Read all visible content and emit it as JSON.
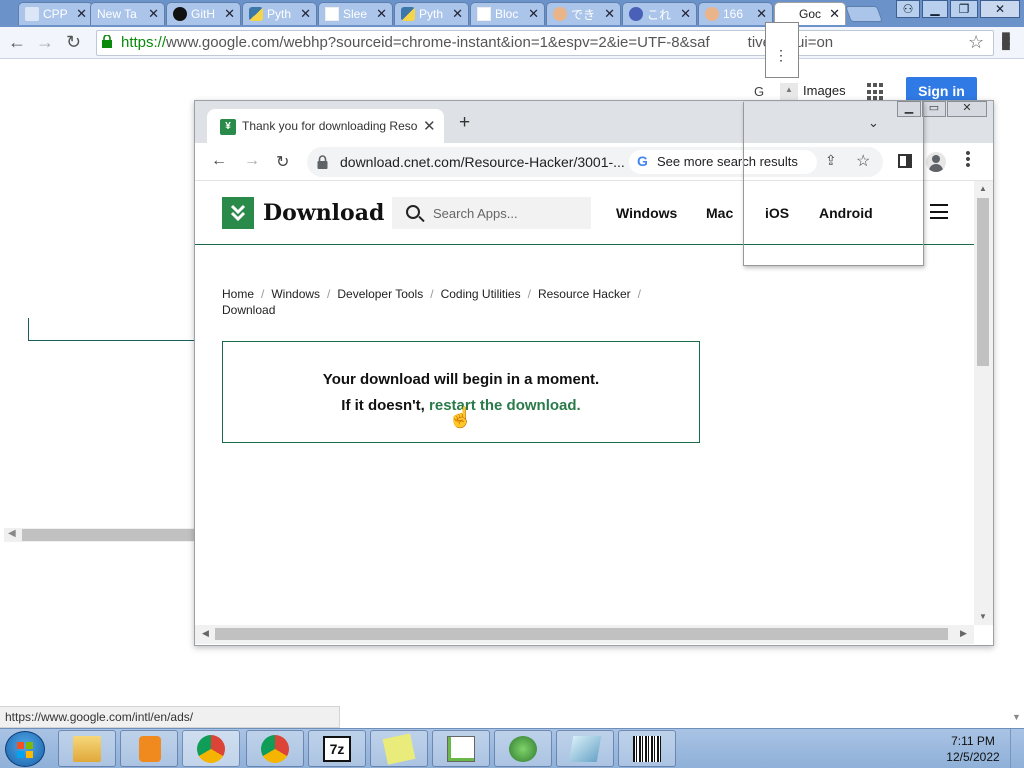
{
  "bg_window": {
    "tabs": [
      {
        "label": "CPP",
        "icon": "chrome-icon"
      },
      {
        "label": "New Ta",
        "icon": "page-icon"
      },
      {
        "label": "GitH",
        "icon": "github-icon"
      },
      {
        "label": "Pyth",
        "icon": "python-icon"
      },
      {
        "label": "Slee",
        "icon": "page-icon"
      },
      {
        "label": "Pyth",
        "icon": "python-icon"
      },
      {
        "label": "Bloc",
        "icon": "page-icon"
      },
      {
        "label": "でき",
        "icon": "anime-icon"
      },
      {
        "label": "これ",
        "icon": "anime-icon"
      },
      {
        "label": "166",
        "icon": "anime-icon"
      },
      {
        "label": "Goc",
        "icon": "google-icon"
      }
    ],
    "url_scheme": "https://",
    "url_rest": "www.google.com/webhp?sourceid=chrome-instant&ion=1&espv=2&ie=UTF-8&saf",
    "url_tail": "tive&ssui=on",
    "google_g": "G",
    "images_label": "Images",
    "signin_label": "Sign in",
    "status_url": "https://www.google.com/intl/en/ads/"
  },
  "fg_window": {
    "tab_title": "Thank you for downloading Resource Hacker",
    "new_tab_label": "+",
    "tab_search_label": "⌄",
    "url": "download.cnet.com/Resource-Hacker/3001-...",
    "chip_label": "See more search results",
    "chip_logo": "G"
  },
  "site": {
    "logo_text": "Download",
    "search_placeholder": "Search Apps...",
    "nav": [
      "Windows",
      "Mac",
      "iOS",
      "Android"
    ],
    "breadcrumb": [
      "Home",
      "Windows",
      "Developer Tools",
      "Coding Utilities",
      "Resource Hacker",
      "Download"
    ],
    "breadcrumb_sep": "/",
    "message_line1": "Your download will begin in a moment.",
    "message_line2_prefix": "If it doesn't,",
    "message_link": "restart the download."
  },
  "taskbar": {
    "time": "7:11 PM",
    "date": "12/5/2022",
    "apps": [
      "file-explorer-icon",
      "media-player-icon",
      "chrome-icon",
      "chrome-icon",
      "7zip-icon",
      "sticky-notes-icon",
      "notepad-plus-plus-icon",
      "network-monitor-icon",
      "paint-icon",
      "barcode-icon"
    ],
    "app_7z_label": "7z"
  },
  "colors": {
    "cnet_green": "#2a8a4a",
    "link_green": "#2a7a4a",
    "google_blue": "#2f7ae5"
  }
}
